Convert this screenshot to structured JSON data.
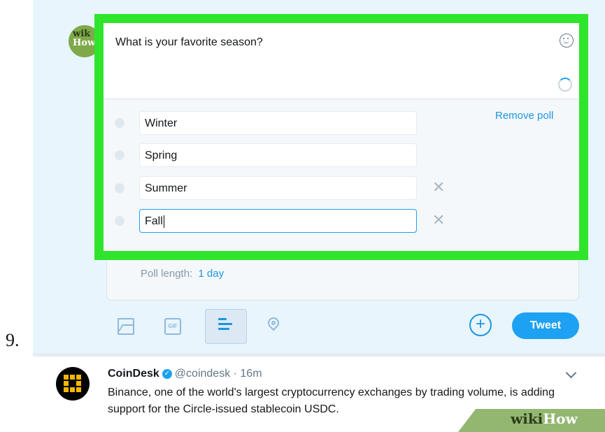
{
  "step_number": "9.",
  "avatar": {
    "line1": "wik",
    "line2": "How"
  },
  "compose": {
    "question": "What is your favorite season?",
    "remove_poll_label": "Remove poll",
    "options": [
      "Winter",
      "Spring",
      "Summer",
      "Fall"
    ],
    "poll_length_label": "Poll length:",
    "poll_length_value": "1 day",
    "tweet_button_label": "Tweet",
    "add_button_symbol": "+",
    "gif_icon_label": "GIF"
  },
  "feed_tweet": {
    "name": "CoinDesk",
    "handle_time": "@coindesk · 16m",
    "text": "Binance, one of the world's largest cryptocurrency exchanges by trading volume, is adding support for the Circle-issued stablecoin USDC."
  },
  "watermark": {
    "part1": "wiki",
    "part2": "How"
  },
  "colors": {
    "highlight": "#2ee52b",
    "accent": "#1da1f2",
    "link": "#1b95e0",
    "wikihow_green": "#93b771"
  },
  "icons": [
    "emoji-icon",
    "progress-ring-icon",
    "media-icon",
    "gif-icon",
    "poll-icon",
    "location-icon",
    "add-tweet-icon",
    "verified-icon",
    "chevron-down-icon",
    "remove-option-icon"
  ]
}
